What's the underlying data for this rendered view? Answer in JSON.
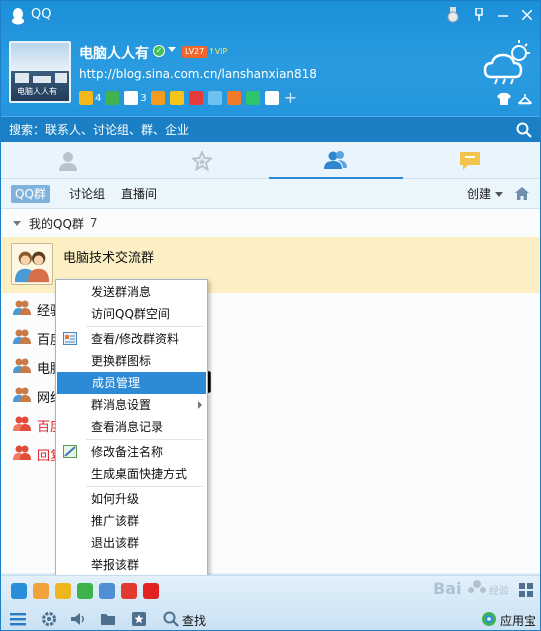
{
  "window": {
    "title": "QQ"
  },
  "profile": {
    "nickname": "电脑人人有",
    "level": "LV27",
    "vip": "↑VIP",
    "signature": "http://blog.sina.com.cn/lanshanxian818",
    "avatar_caption": "电脑人人有",
    "apps": [
      {
        "icon": "qzone-star-icon",
        "count": "4",
        "color": "#f5b81c"
      },
      {
        "icon": "qq-browser-icon",
        "count": "",
        "color": "#3fb34f"
      },
      {
        "icon": "mail-icon",
        "count": "3",
        "color": "#ffffff"
      },
      {
        "icon": "shopping-cart-icon",
        "count": "",
        "color": "#f39b1e"
      },
      {
        "icon": "wallet-icon",
        "count": "",
        "color": "#f5c518"
      },
      {
        "icon": "games-icon",
        "count": "",
        "color": "#e53b3b"
      },
      {
        "icon": "pet-icon",
        "count": "",
        "color": "#6cc2f0"
      },
      {
        "icon": "weibo-icon",
        "count": "",
        "color": "#f07a28"
      },
      {
        "icon": "qq-music-icon",
        "count": "",
        "color": "#2ec46a"
      },
      {
        "icon": "qq-doctor-icon",
        "count": "",
        "color": "#ffffff"
      }
    ]
  },
  "search": {
    "placeholder": "搜索：联系人、讨论组、群、企业"
  },
  "main_tabs": [
    {
      "icon": "contacts-icon",
      "active": false
    },
    {
      "icon": "favorites-star-icon",
      "active": false
    },
    {
      "icon": "groups-icon",
      "active": true
    },
    {
      "icon": "messages-icon",
      "active": false
    }
  ],
  "sub_tabs": {
    "qq_groups": "QQ群",
    "discussions": "讨论组",
    "live": "直播间",
    "create": "创建"
  },
  "group_list": {
    "category": "我的QQ群",
    "count": "7",
    "selected": "电脑技术交流群",
    "rows": [
      {
        "name": "经验交流群",
        "red": false
      },
      {
        "name": "百度经验群",
        "red": false
      },
      {
        "name": "电脑爱好者",
        "red": false
      },
      {
        "name": "网络技术群",
        "red": false
      },
      {
        "name": "百度知道群",
        "red": true
      },
      {
        "name": "回复交流群",
        "red": true
      }
    ]
  },
  "context_menu": {
    "items": [
      {
        "label": "发送群消息",
        "icon": "",
        "highlight": false,
        "submenu": false
      },
      {
        "label": "访问QQ群空间",
        "icon": "",
        "highlight": false,
        "submenu": false
      },
      {
        "sep": true
      },
      {
        "label": "查看/修改群资料",
        "icon": "group-info-icon",
        "highlight": false,
        "submenu": false
      },
      {
        "label": "更换群图标",
        "icon": "",
        "highlight": false,
        "submenu": false
      },
      {
        "label": "成员管理",
        "icon": "",
        "highlight": true,
        "submenu": false
      },
      {
        "label": "群消息设置",
        "icon": "",
        "highlight": false,
        "submenu": true
      },
      {
        "label": "查看消息记录",
        "icon": "",
        "highlight": false,
        "submenu": false
      },
      {
        "sep": true
      },
      {
        "label": "修改备注名称",
        "icon": "edit-remark-icon",
        "highlight": false,
        "submenu": false
      },
      {
        "label": "生成桌面快捷方式",
        "icon": "",
        "highlight": false,
        "submenu": false
      },
      {
        "sep": true
      },
      {
        "label": "如何升级",
        "icon": "",
        "highlight": false,
        "submenu": false
      },
      {
        "label": "推广该群",
        "icon": "",
        "highlight": false,
        "submenu": false
      },
      {
        "label": "退出该群",
        "icon": "",
        "highlight": false,
        "submenu": false
      },
      {
        "label": "举报该群",
        "icon": "",
        "highlight": false,
        "submenu": false
      }
    ]
  },
  "bottom": {
    "apps": [
      {
        "icon": "qq-browser-icon",
        "color": "#2a8fd8"
      },
      {
        "icon": "game-character-icon",
        "color": "#f2a23a"
      },
      {
        "icon": "qq-music-icon",
        "color": "#f0b61f"
      },
      {
        "icon": "video-play-icon",
        "color": "#3bb24a"
      },
      {
        "icon": "qq-game-icon",
        "color": "#4f8ed4"
      },
      {
        "icon": "red-app-icon",
        "color": "#e33a2f"
      },
      {
        "icon": "jd-icon",
        "color": "#e32222"
      }
    ],
    "find_label": "查找",
    "app_store_label": "应用宝"
  },
  "watermark": "Baidu经验",
  "colors": {
    "header_blue": "#1b8fd9",
    "search_blue": "#1a7fc4",
    "highlight_blue": "#2d8ad6",
    "selected_row": "#fcefc4",
    "red_name": "#e02222"
  }
}
